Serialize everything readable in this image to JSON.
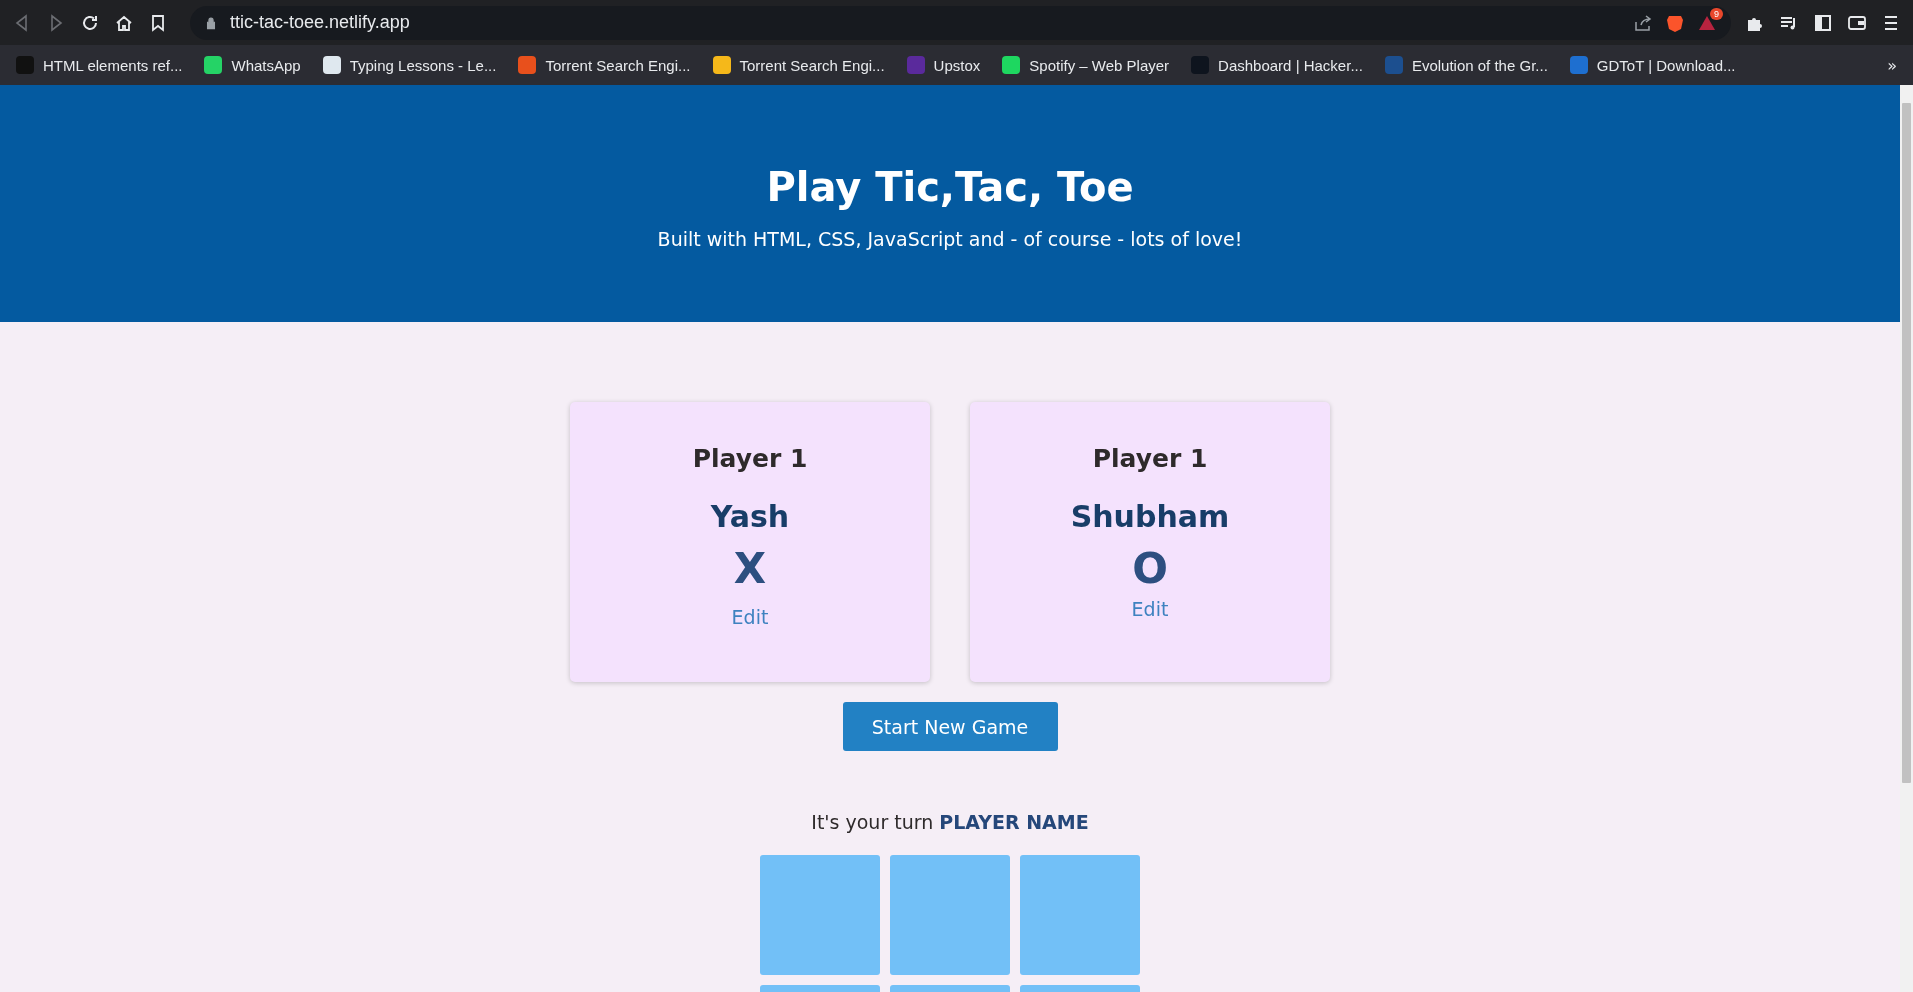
{
  "browser": {
    "url": "ttic-tac-toee.netlify.app",
    "rewards_badge": "9",
    "overflow": "»"
  },
  "bookmarks": [
    {
      "label": "HTML elements ref...",
      "color": "#111111"
    },
    {
      "label": "WhatsApp",
      "color": "#25d366"
    },
    {
      "label": "Typing Lessons - Le...",
      "color": "#dfe8ef"
    },
    {
      "label": "Torrent Search Engi...",
      "color": "#e8501c"
    },
    {
      "label": "Torrent Search Engi...",
      "color": "#f5b81a"
    },
    {
      "label": "Upstox",
      "color": "#5a2a9c"
    },
    {
      "label": "Spotify – Web Player",
      "color": "#1ed760"
    },
    {
      "label": "Dashboard | Hacker...",
      "color": "#0e141e"
    },
    {
      "label": "Evolution of the Gr...",
      "color": "#1c4f8f"
    },
    {
      "label": "GDToT | Download...",
      "color": "#1e6fd0"
    }
  ],
  "header": {
    "title": "Play Tic,Tac, Toe",
    "subtitle": "Built with HTML, CSS, JavaScript and - of course - lots of love!"
  },
  "players": [
    {
      "heading": "Player 1",
      "name": "Yash",
      "symbol": "X",
      "edit": "Edit"
    },
    {
      "heading": "Player 1",
      "name": "Shubham",
      "symbol": "O",
      "edit": "Edit"
    }
  ],
  "start_button": "Start New Game",
  "turn": "It's your turn **PLAYER NAME**"
}
